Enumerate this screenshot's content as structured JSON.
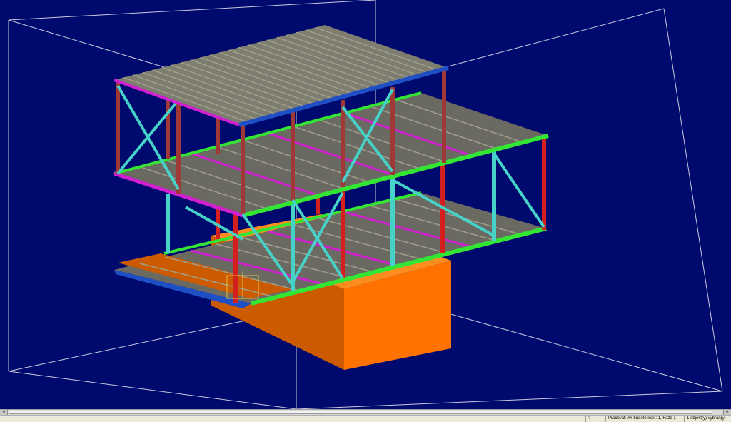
{
  "viewport": {
    "background": "#000a6e",
    "frame_color": "#c9c9dc"
  },
  "colors": {
    "deck": "#6a6a62",
    "deck_rib": "#a0a08c",
    "roof": "#7d7d70",
    "roof_edge": "#1e4fc4",
    "beam_green": "#34e634",
    "beam_magenta": "#d21fd2",
    "column_red": "#d41f1f",
    "column_dark_red": "#a13838",
    "brace_cyan": "#46d2c8",
    "base_orange_left": "#cc5a00",
    "base_orange_right": "#ff7200",
    "base_orange_top": "#ff8c1e"
  },
  "scrollbar": {
    "left_arrow": "◂",
    "right_arrow": "▸"
  },
  "statusbar": {
    "pane1": "?",
    "pane2": "Pracovat: ## budete léze: 1, Fáze 1",
    "pane3": "1 objekt(y) vybrán(y)"
  }
}
